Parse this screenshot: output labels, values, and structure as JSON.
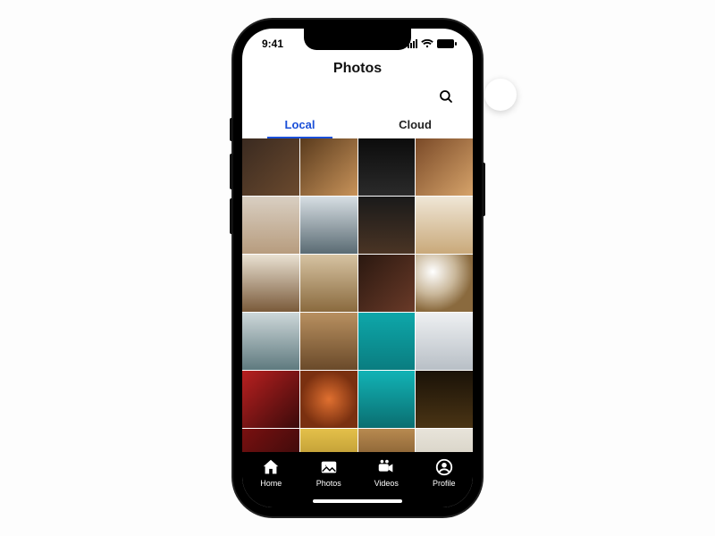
{
  "statusbar": {
    "time": "9:41"
  },
  "header": {
    "title": "Photos"
  },
  "tabs": [
    {
      "label": "Local",
      "active": true
    },
    {
      "label": "Cloud",
      "active": false
    }
  ],
  "nav": [
    {
      "label": "Home",
      "icon": "home-icon"
    },
    {
      "label": "Photos",
      "icon": "photos-icon"
    },
    {
      "label": "Videos",
      "icon": "videos-icon"
    },
    {
      "label": "Profile",
      "icon": "profile-icon"
    }
  ],
  "grid": {
    "rows": 6,
    "cols": 4
  },
  "colors": {
    "accent": "#1a4fd8"
  }
}
